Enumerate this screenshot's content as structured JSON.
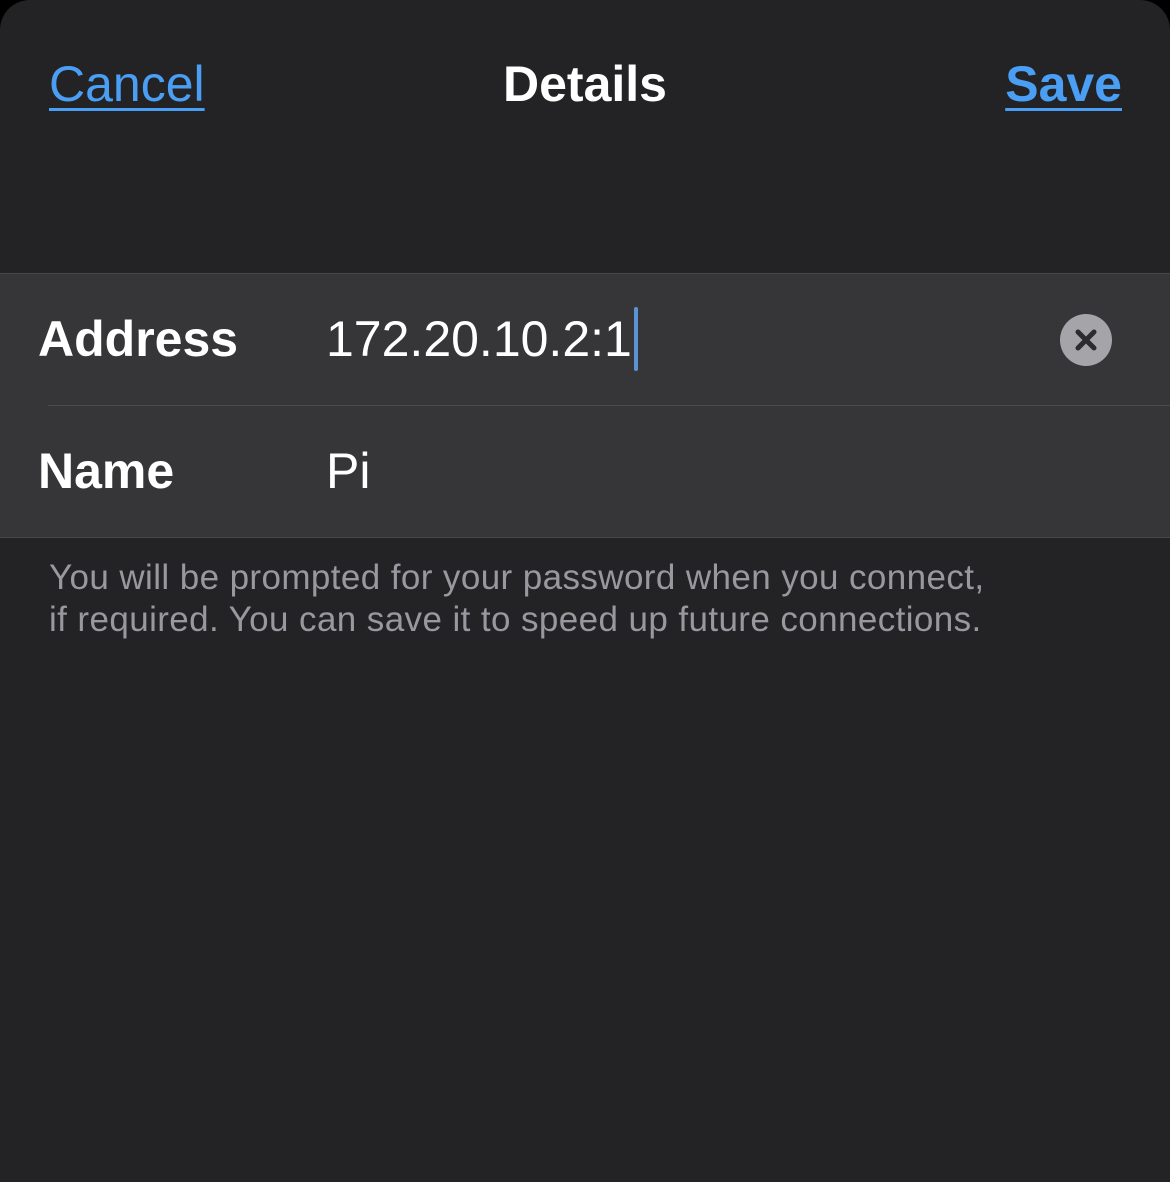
{
  "nav": {
    "cancel_label": "Cancel",
    "title": "Details",
    "save_label": "Save"
  },
  "form": {
    "address": {
      "label": "Address",
      "value": "172.20.10.2:1",
      "clear_icon": "clear-circle-x-icon"
    },
    "name": {
      "label": "Name",
      "value": "Pi"
    }
  },
  "footer": {
    "line1": "You will be prompted for your password when you connect,",
    "line2": "if required. You can save it to speed up future connections."
  },
  "colors": {
    "accent": "#4a9ff5",
    "sheet_background": "#232325",
    "group_background": "#363638",
    "caret": "#5b93d6",
    "secondary_text": "#98989e"
  }
}
